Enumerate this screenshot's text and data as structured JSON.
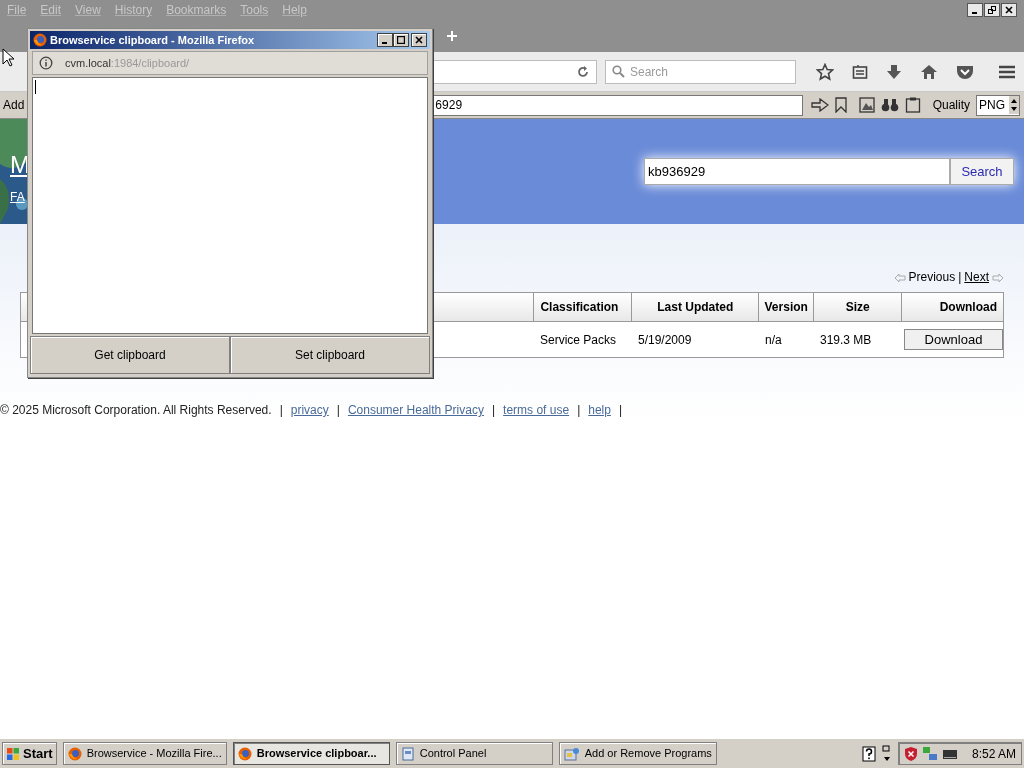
{
  "browser": {
    "menu": [
      "File",
      "Edit",
      "View",
      "History",
      "Bookmarks",
      "Tools",
      "Help"
    ],
    "nav": {
      "search_placeholder": "Search"
    },
    "addon_bar": {
      "label": "Add",
      "field_value": "6929",
      "quality_label": "Quality",
      "format": "PNG"
    }
  },
  "page": {
    "header": {
      "logo_fragment": "M",
      "link_fragment": "FA",
      "search_value": "kb936929",
      "search_button": "Search"
    },
    "pager": {
      "previous": "Previous",
      "separator": "|",
      "next": "Next"
    },
    "table": {
      "columns": [
        "Classification",
        "Last Updated",
        "Version",
        "Size",
        "Download"
      ],
      "rows": [
        {
          "classification": "Service Packs",
          "last_updated": "5/19/2009",
          "version": "n/a",
          "size": "319.3 MB",
          "download": "Download"
        }
      ]
    },
    "footer": {
      "copyright": "© 2025 Microsoft Corporation. All Rights Reserved.",
      "separator": "|",
      "links": [
        "privacy",
        "Consumer Health Privacy",
        "terms of use",
        "help"
      ]
    }
  },
  "popup": {
    "title": "Browservice clipboard - Mozilla Firefox",
    "url": {
      "host": "cvm.local",
      "path": ":1984/clipboard/"
    },
    "buttons": [
      "Get clipboard",
      "Set clipboard"
    ]
  },
  "taskbar": {
    "start": "Start",
    "tasks": [
      {
        "label": "Browservice - Mozilla Fire...",
        "kind": "browser",
        "selected": false
      },
      {
        "label": "Browservice clipboar...",
        "kind": "browser",
        "selected": true
      },
      {
        "label": "Control Panel",
        "kind": "panel",
        "selected": false
      },
      {
        "label": "Add or Remove Programs",
        "kind": "installer",
        "selected": false
      }
    ],
    "clock": "8:52 AM"
  }
}
